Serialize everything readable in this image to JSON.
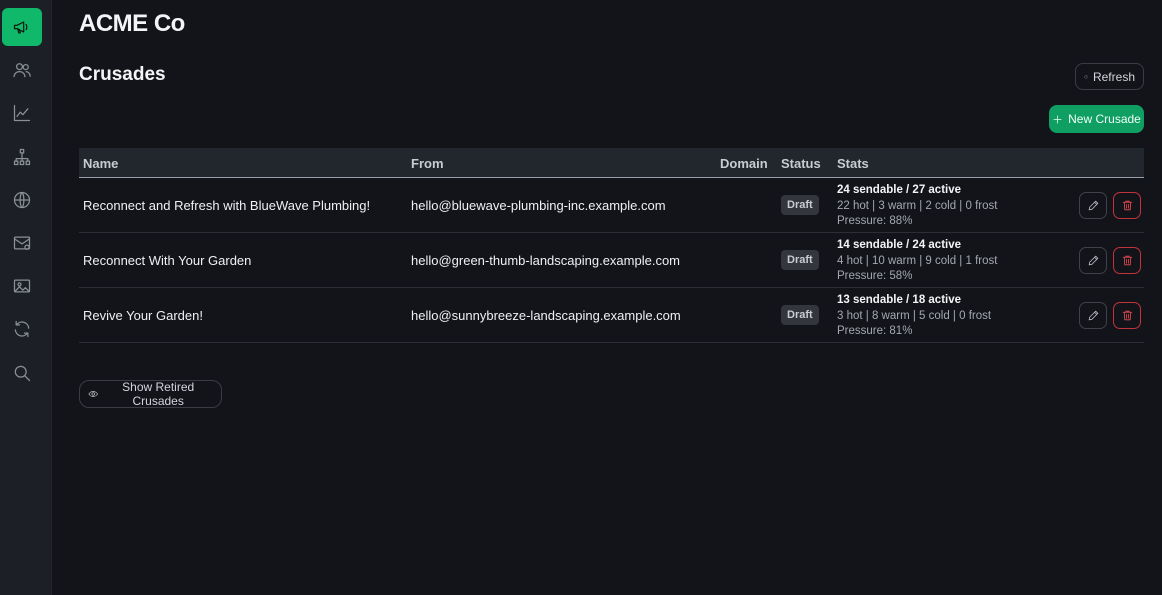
{
  "app": {
    "brand": "ACME Co"
  },
  "sidebar": {
    "items": [
      {
        "icon": "megaphone-icon",
        "active": true
      },
      {
        "icon": "users-icon",
        "active": false
      },
      {
        "icon": "line-chart-icon",
        "active": false
      },
      {
        "icon": "hierarchy-icon",
        "active": false
      },
      {
        "icon": "globe-icon",
        "active": false
      },
      {
        "icon": "mail-icon",
        "active": false
      },
      {
        "icon": "image-icon",
        "active": false
      },
      {
        "icon": "sync-icon",
        "active": false
      },
      {
        "icon": "search-icon",
        "active": false
      }
    ]
  },
  "page": {
    "title": "Crusades",
    "refresh_label": "Refresh",
    "new_label": "New Crusade",
    "show_retired_label": "Show Retired Crusades"
  },
  "table": {
    "columns": [
      "Name",
      "From",
      "Domain",
      "Status",
      "Stats"
    ],
    "rows": [
      {
        "name": "Reconnect and Refresh with BlueWave Plumbing!",
        "from": "hello@bluewave-plumbing-inc.example.com",
        "domain": "",
        "status": "Draft",
        "stats_main": "24 sendable / 27 active",
        "stats_temps": "22 hot | 3 warm | 2 cold | 0 frost",
        "stats_pressure": "Pressure: 88%"
      },
      {
        "name": "Reconnect With Your Garden",
        "from": "hello@green-thumb-landscaping.example.com",
        "domain": "",
        "status": "Draft",
        "stats_main": "14 sendable / 24 active",
        "stats_temps": "4 hot | 10 warm | 9 cold | 1 frost",
        "stats_pressure": "Pressure: 58%"
      },
      {
        "name": "Revive Your Garden!",
        "from": "hello@sunnybreeze-landscaping.example.com",
        "domain": "",
        "status": "Draft",
        "stats_main": "13 sendable / 18 active",
        "stats_temps": "3 hot | 8 warm | 5 cold | 0 frost",
        "stats_pressure": "Pressure: 81%"
      }
    ]
  },
  "colors": {
    "accent": "#10b96a",
    "primary_button": "#0f9f62",
    "danger": "#ef4b55",
    "background": "#131419",
    "sidebar": "#1d1f26"
  }
}
